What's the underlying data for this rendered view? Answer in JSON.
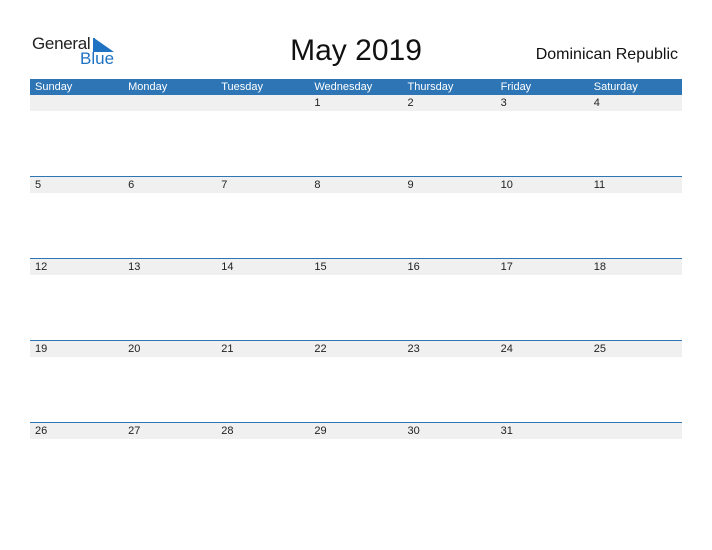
{
  "logo": {
    "part1": "General",
    "part2": "Blue"
  },
  "title": "May 2019",
  "country": "Dominican Republic",
  "colors": {
    "accent": "#2e75b6",
    "row_bg": "#f0f0f0"
  },
  "weekdays": [
    "Sunday",
    "Monday",
    "Tuesday",
    "Wednesday",
    "Thursday",
    "Friday",
    "Saturday"
  ],
  "weeks": [
    [
      "",
      "",
      "",
      "1",
      "2",
      "3",
      "4"
    ],
    [
      "5",
      "6",
      "7",
      "8",
      "9",
      "10",
      "11"
    ],
    [
      "12",
      "13",
      "14",
      "15",
      "16",
      "17",
      "18"
    ],
    [
      "19",
      "20",
      "21",
      "22",
      "23",
      "24",
      "25"
    ],
    [
      "26",
      "27",
      "28",
      "29",
      "30",
      "31",
      ""
    ]
  ]
}
